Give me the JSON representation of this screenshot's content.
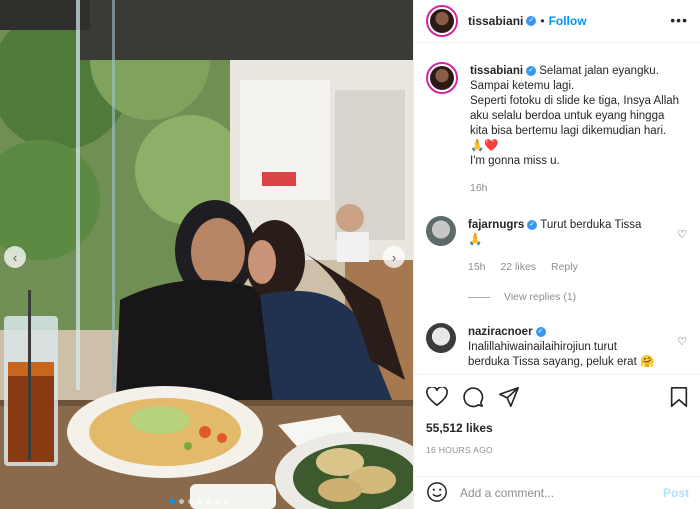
{
  "header": {
    "username": "tissabiani",
    "follow_label": "Follow",
    "more_icon": "more-dots-icon"
  },
  "caption": {
    "username": "tissabiani",
    "lines": [
      "Selamat jalan eyangku.",
      "Sampai ketemu lagi.",
      "Seperti fotoku di slide ke tiga, Insya Allah",
      "aku selalu berdoa untuk eyang hingga",
      "kita bisa bertemu lagi dikemudian hari.",
      "🙏❤️",
      "I'm gonna miss u."
    ],
    "time": "16h"
  },
  "comments": [
    {
      "username": "fajarnugrs",
      "text": "Turut berduka Tissa",
      "text2": "🙏",
      "time": "15h",
      "likes": "22 likes",
      "reply_label": "Reply",
      "view_replies": "View replies (1)"
    },
    {
      "username": "naziracnoer",
      "text": "Inalillahiwainailaihirojiun turut",
      "text2": "berduka Tissa sayang, peluk erat 🤗"
    }
  ],
  "actions": {
    "likes": "55,512 likes",
    "timestamp": "16 HOURS AGO"
  },
  "add_comment": {
    "placeholder": "Add a comment...",
    "post_label": "Post"
  },
  "carousel": {
    "slide_count": 7,
    "active_index": 0
  }
}
